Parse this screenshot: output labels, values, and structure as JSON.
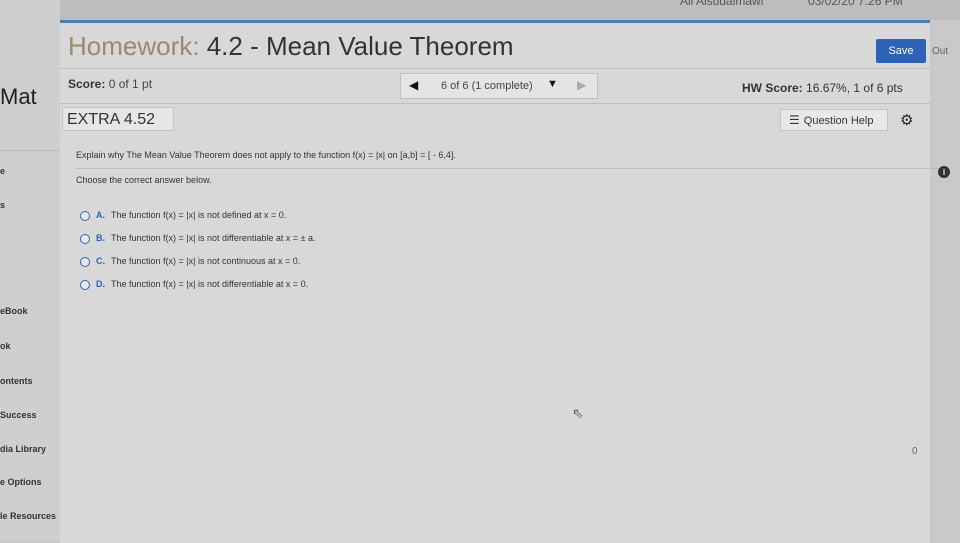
{
  "topbar": {
    "user": "Ali Alsudaimawi",
    "datetime": "03/02/20 7:26 PM"
  },
  "sidebar": {
    "brand": "Mat",
    "items": [
      "e",
      "s",
      "eBook",
      "ok",
      "ontents",
      "Success",
      "dia Library",
      "e Options",
      "le Resources"
    ]
  },
  "header": {
    "title_prefix": "Homework:",
    "title_rest": " 4.2 - Mean Value Theorem",
    "save_label": "Save",
    "right_edge": "Out"
  },
  "status": {
    "score_label": "Score:",
    "score_value": " 0 of 1 pt",
    "position": "6 of 6 (1 complete)",
    "hw_score_label": "HW Score:",
    "hw_score_value": " 16.67%, 1 of 6 pts"
  },
  "question": {
    "id": "EXTRA 4.52",
    "help_label": "Question Help",
    "prompt": "Explain why The Mean Value Theorem does not apply to the function f(x) = |x| on [a,b] = [ - 6,4].",
    "instruction": "Choose the correct answer below.",
    "options": [
      {
        "letter": "A.",
        "text": "The function f(x) = |x| is not defined at x = 0."
      },
      {
        "letter": "B.",
        "text": "The function f(x) = |x| is not differentiable at x = ± a."
      },
      {
        "letter": "C.",
        "text": "The function f(x) = |x| is not continuous at x = 0."
      },
      {
        "letter": "D.",
        "text": "The function f(x) = |x| is not differentiable at x = 0."
      }
    ]
  },
  "misc": {
    "right_edge_zero": "0"
  },
  "colors": {
    "accent": "#2e62b8",
    "title_prefix": "#9a8c6a"
  }
}
